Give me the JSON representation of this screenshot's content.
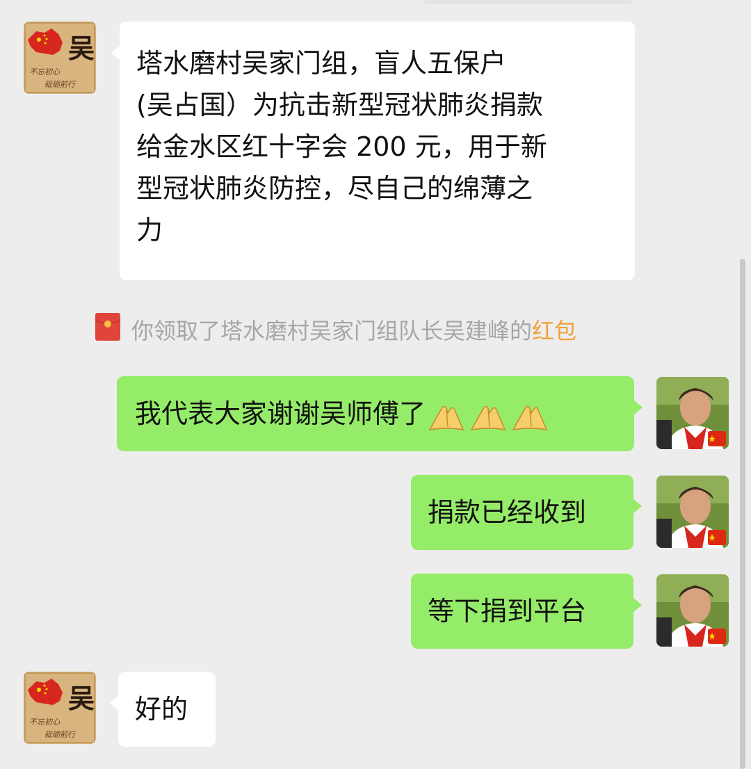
{
  "messages": [
    {
      "side": "in",
      "sender_avatar_text": "吴",
      "sender_avatar_tagline_1": "不忘初心",
      "sender_avatar_tagline_2": "砥砺前行",
      "text_lines": [
        "塔水磨村吴家门组，盲人五保户",
        "(吴占国）为抗击新型冠状肺炎捐款",
        "给金水区红十字会 200 元，用于新",
        "型冠状肺炎防控，尽自己的绵薄之",
        "力"
      ]
    },
    {
      "side": "out",
      "text": "我代表大家谢谢吴师傅了",
      "emoji_name": "folded-hands-icon",
      "emoji_count": 3
    },
    {
      "side": "out",
      "text": "捐款已经收到"
    },
    {
      "side": "out",
      "text": "等下捐到平台"
    },
    {
      "side": "in",
      "sender_avatar_text": "吴",
      "sender_avatar_tagline_1": "不忘初心",
      "sender_avatar_tagline_2": "砥砺前行",
      "text": "好的"
    }
  ],
  "system_notice": {
    "icon": "red-packet-icon",
    "text": "你领取了塔水磨村吴家门组队长吴建峰的",
    "link_text": "红包"
  },
  "colors": {
    "background": "#ededed",
    "incoming_bubble": "#ffffff",
    "outgoing_bubble": "#95ec69",
    "system_text": "#a6a6a6",
    "red_packet_link": "#f0a03a",
    "red_packet_icon": "#e0453c"
  }
}
